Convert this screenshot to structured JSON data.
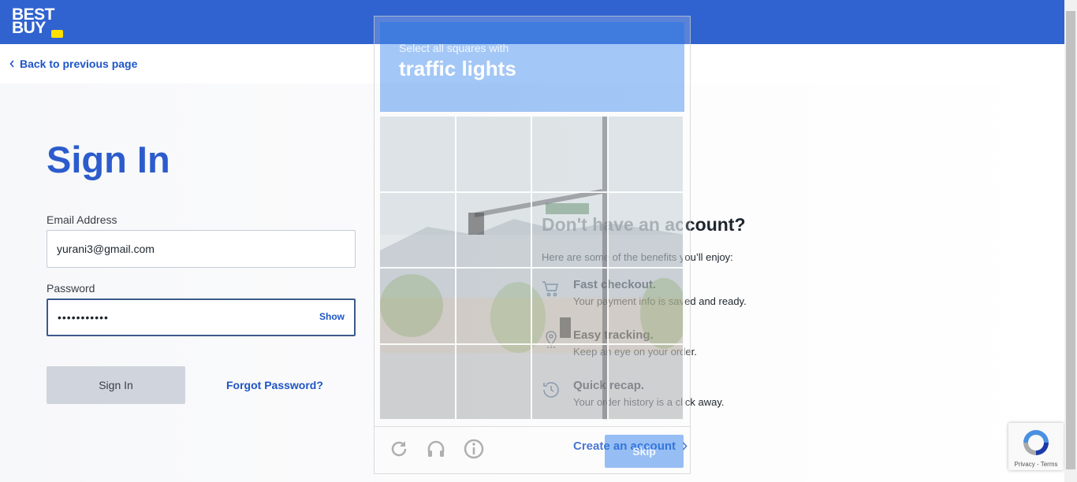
{
  "header": {
    "logo_line1": "BEST",
    "logo_line2": "BUY",
    "brand_color": "#3063cf",
    "tag_color": "#ffe000"
  },
  "nav": {
    "back_label": "Back to previous page"
  },
  "signin": {
    "title": "Sign In",
    "email_label": "Email Address",
    "email_value": "yurani3@gmail.com",
    "password_label": "Password",
    "password_value": "•••••••••••",
    "show_label": "Show",
    "submit_label": "Sign In",
    "forgot_label": "Forgot Password?"
  },
  "account": {
    "title": "Don't have an account?",
    "intro": "Here are some of the benefits you’ll enjoy:",
    "benefits": [
      {
        "icon": "cart-icon",
        "title": "Fast checkout.",
        "desc": "Your payment info is saved and ready."
      },
      {
        "icon": "location-pin-icon",
        "title": "Easy tracking.",
        "desc": "Keep an eye on your order."
      },
      {
        "icon": "clock-history-icon",
        "title": "Quick recap.",
        "desc": "Your order history is a click away."
      }
    ],
    "create_label": "Create an account"
  },
  "captcha": {
    "instruction": "Select all squares with",
    "target": "traffic lights",
    "skip_label": "Skip",
    "icons": [
      "reload-icon",
      "audio-icon",
      "info-icon"
    ]
  },
  "recaptcha_badge": {
    "text": "Privacy - Terms"
  }
}
